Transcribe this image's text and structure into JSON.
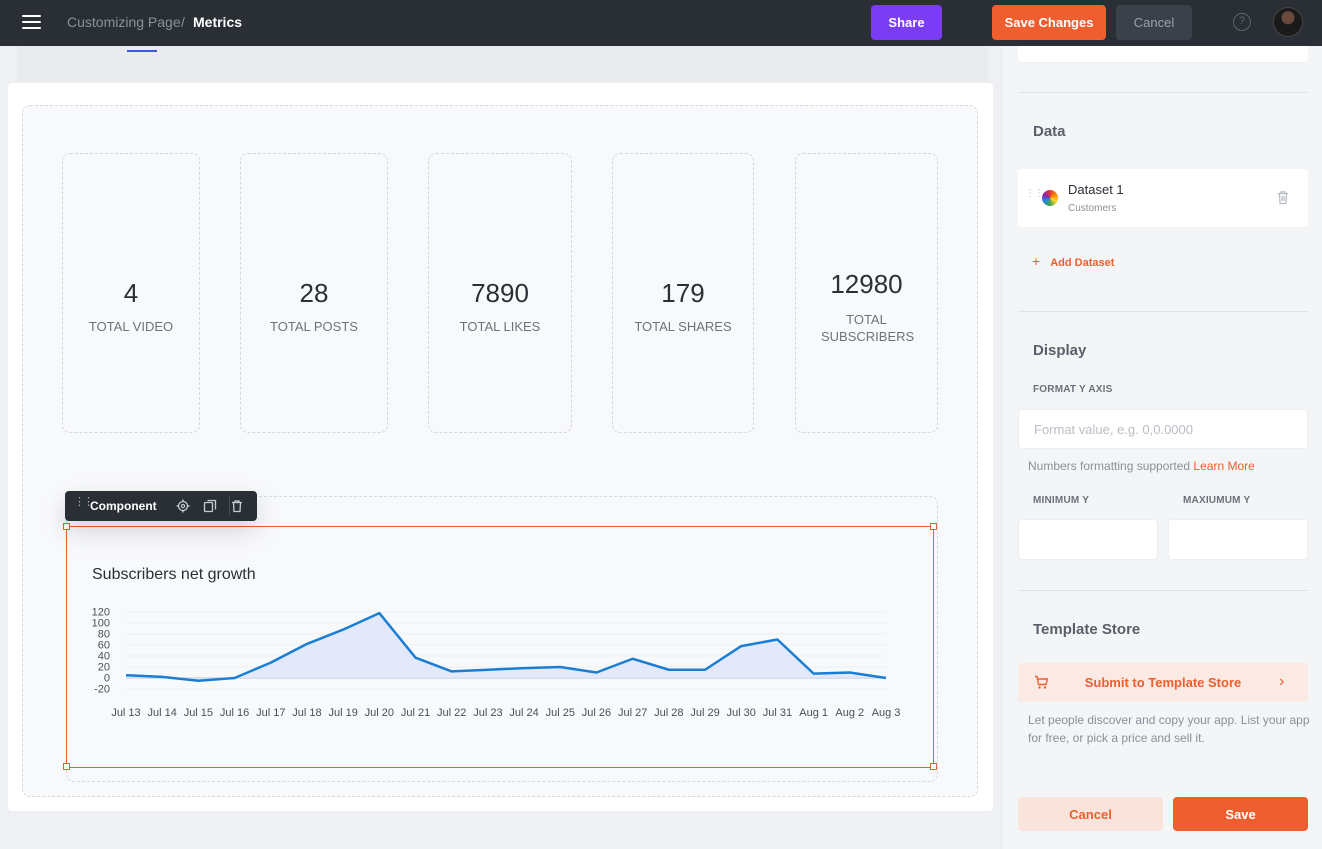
{
  "header": {
    "breadcrumb_root": "Customizing Page",
    "breadcrumb_separator": "/",
    "breadcrumb_current": "Metrics",
    "share_label": "Share",
    "save_changes_label": "Save Changes",
    "cancel_label": "Cancel",
    "help_symbol": "?",
    "icons": [
      "menu-icon",
      "help-icon",
      "avatar"
    ]
  },
  "stats": [
    {
      "value": "4",
      "label": "TOTAL VIDEO"
    },
    {
      "value": "28",
      "label": "TOTAL POSTS"
    },
    {
      "value": "7890",
      "label": "TOTAL LIKES"
    },
    {
      "value": "179",
      "label": "TOTAL SHARES"
    },
    {
      "value": "12980",
      "label": "TOTAL SUBSCRIBERS"
    }
  ],
  "component_toolbar": {
    "title": "Component",
    "icons": [
      "settings-icon",
      "duplicate-icon",
      "trash-icon"
    ]
  },
  "chart_data": {
    "type": "area",
    "title": "Subscribers net growth",
    "xlabel": "",
    "ylabel": "",
    "ylim": [
      -20,
      120
    ],
    "yticks": [
      120,
      100,
      80,
      60,
      40,
      20,
      0,
      -20
    ],
    "grid": true,
    "legend": "none",
    "line_color": "#1a7fd4",
    "fill_color": "#dde4fb",
    "categories": [
      "Jul 13",
      "Jul 14",
      "Jul 15",
      "Jul 16",
      "Jul 17",
      "Jul 18",
      "Jul 19",
      "Jul 20",
      "Jul 21",
      "Jul 22",
      "Jul 23",
      "Jul 24",
      "Jul 25",
      "Jul 26",
      "Jul 27",
      "Jul 28",
      "Jul 29",
      "Jul 30",
      "Jul 31",
      "Aug 1",
      "Aug 2",
      "Aug 3"
    ],
    "series": [
      {
        "values": [
          5,
          2,
          -5,
          0,
          28,
          62,
          88,
          118,
          37,
          12,
          15,
          18,
          20,
          10,
          35,
          15,
          15,
          58,
          70,
          8,
          10,
          0
        ]
      }
    ]
  },
  "panel": {
    "data_title": "Data",
    "dataset_name": "Dataset 1",
    "dataset_source": "Customers",
    "add_dataset_label": "Add Dataset",
    "add_dataset_symbol": "+",
    "display_title": "Display",
    "format_y_label": "FORMAT Y AXIS",
    "format_y_placeholder": "Format value, e.g. 0,0.0000",
    "format_hint": "Numbers formatting supported",
    "learn_more": "Learn More",
    "min_y_label": "MINIMUM Y",
    "max_y_label": "MAXIUMUM Y",
    "min_y_value": "",
    "max_y_value": "",
    "template_title": "Template Store",
    "submit_template_label": "Submit to Template Store",
    "chevron": "›",
    "template_desc": "Let people discover and copy your app. List your app for free, or pick a price and sell it.",
    "cancel_label": "Cancel",
    "save_label": "Save",
    "icons": [
      "drag-handle-icon",
      "dataset-color-icon",
      "trash-icon",
      "plus-icon",
      "cart-icon",
      "chevron-right-icon"
    ]
  },
  "colors": {
    "brand": "#ee5e2f",
    "share": "#7b3cf5",
    "topbar": "#2a2f36"
  }
}
